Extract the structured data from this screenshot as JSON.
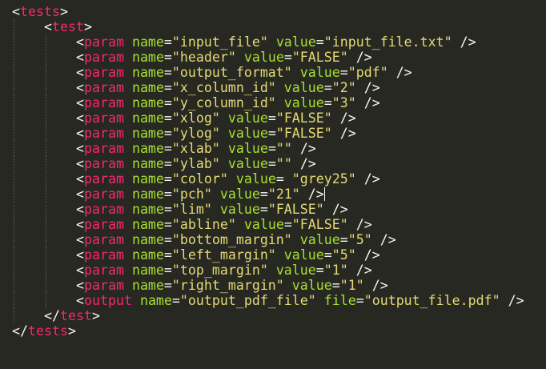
{
  "colors": {
    "background": "#272822",
    "tag": "#f92672",
    "attribute": "#a6e22e",
    "string": "#e6db74",
    "punctuation": "#f8f8f2"
  },
  "code": {
    "root_open": "tests",
    "test_open": "test",
    "param_tag": "param",
    "output_tag": "output",
    "test_close": "test",
    "root_close": "tests",
    "params": [
      {
        "name": "\"input_file\"",
        "value": "\"input_file.txt\""
      },
      {
        "name": "\"header\"",
        "value": "\"FALSE\""
      },
      {
        "name": "\"output_format\"",
        "value": "\"pdf\""
      },
      {
        "name": "\"x_column_id\"",
        "value": "\"2\""
      },
      {
        "name": "\"y_column_id\"",
        "value": "\"3\""
      },
      {
        "name": "\"xlog\"",
        "value": "\"FALSE\""
      },
      {
        "name": "\"ylog\"",
        "value": "\"FALSE\""
      },
      {
        "name": "\"xlab\"",
        "value": "\"\""
      },
      {
        "name": "\"ylab\"",
        "value": "\"\""
      },
      {
        "name": "\"color\"",
        "value": "\"grey25\""
      },
      {
        "name": "\"pch\"",
        "value": "\"21\""
      },
      {
        "name": "\"lim\"",
        "value": "\"FALSE\""
      },
      {
        "name": "\"abline\"",
        "value": "\"FALSE\""
      },
      {
        "name": "\"bottom_margin\"",
        "value": "\"5\""
      },
      {
        "name": "\"left_margin\"",
        "value": "\"5\""
      },
      {
        "name": "\"top_margin\"",
        "value": "\"1\""
      },
      {
        "name": "\"right_margin\"",
        "value": "\"1\""
      }
    ],
    "output": {
      "name": "\"output_pdf_file\"",
      "file": "\"output_file.pdf\""
    }
  }
}
